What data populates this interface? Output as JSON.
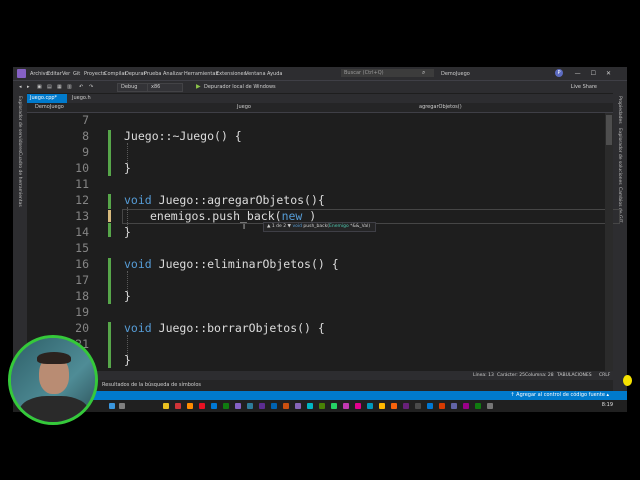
{
  "titlebar": {
    "menu": [
      "Archivo",
      "Editar",
      "Ver",
      "Git",
      "Proyecto",
      "Compilar",
      "Depurar",
      "Prueba",
      "Analizar",
      "Herramientas",
      "Extensiones",
      "Ventana",
      "Ayuda"
    ],
    "search_placeholder": "Buscar (Ctrl+Q)",
    "solution_name": "DemoJuego",
    "profile_initial": "P"
  },
  "toolbar": {
    "config": "Debug",
    "platform": "x86",
    "debugger": "Depurador local de Windows",
    "live_share": "Live Share"
  },
  "left_rail": {
    "items": [
      "Explorador de servidores",
      "Cuadro de herramientas"
    ]
  },
  "right_rail": {
    "items": [
      "Propiedades",
      "Explorador de soluciones",
      "Cambios de GIT"
    ]
  },
  "tabs": [
    {
      "label": "Juego.cpp*",
      "active": true
    },
    {
      "label": "Juego.h",
      "active": false
    }
  ],
  "navbar": {
    "project": "DemoJuego",
    "scope": "Juego",
    "member": "agregarObjetos()"
  },
  "editor": {
    "line_numbers": [
      "7",
      "8",
      "9",
      "10",
      "11",
      "12",
      "13",
      "14",
      "15",
      "16",
      "17",
      "18",
      "19",
      "20",
      "21"
    ],
    "code": {
      "l8_class": "Juego",
      "l8_sep": "::~",
      "l8_rest": "Juego() {",
      "l10_brace": "}",
      "l12_kw": "void",
      "l12_class": "Juego",
      "l12_sep": "::",
      "l12_rest": "agregarObjetos(){",
      "l13_text": "enemigos.push_back(",
      "l13_kw": "new",
      "l13_close": " )",
      "l14_brace": "}",
      "l16_kw": "void",
      "l16_class": "Juego",
      "l16_sep": "::",
      "l16_rest": "eliminarObjetos() {",
      "l18_brace": "}",
      "l20_kw": "void",
      "l20_class": "Juego",
      "l20_sep": "::",
      "l20_rest": "borrarObjetos() {",
      "l21_brace": "}"
    }
  },
  "tooltip": {
    "counter": "▲ 1 de 2 ▼",
    "kw": "void",
    "fn": " push_back(",
    "type": "Enemigo",
    "rest": " *&&_Val)"
  },
  "statusstrip": {
    "line": "Línea: 13",
    "char": "Carácter: 25",
    "col": "Columna: 28",
    "tabs": "TABULACIONES",
    "eol": "CRLF"
  },
  "output_panel": {
    "text": "Resultados de la búsqueda de símbolos"
  },
  "statusbar": {
    "source_control": "↑ Agregar al control de código fuente ▴"
  },
  "taskbar": {
    "clock": "8:19"
  },
  "colors": {
    "accent": "#007acc",
    "keyword": "#569cd6",
    "webcam_ring": "#35c93a"
  }
}
